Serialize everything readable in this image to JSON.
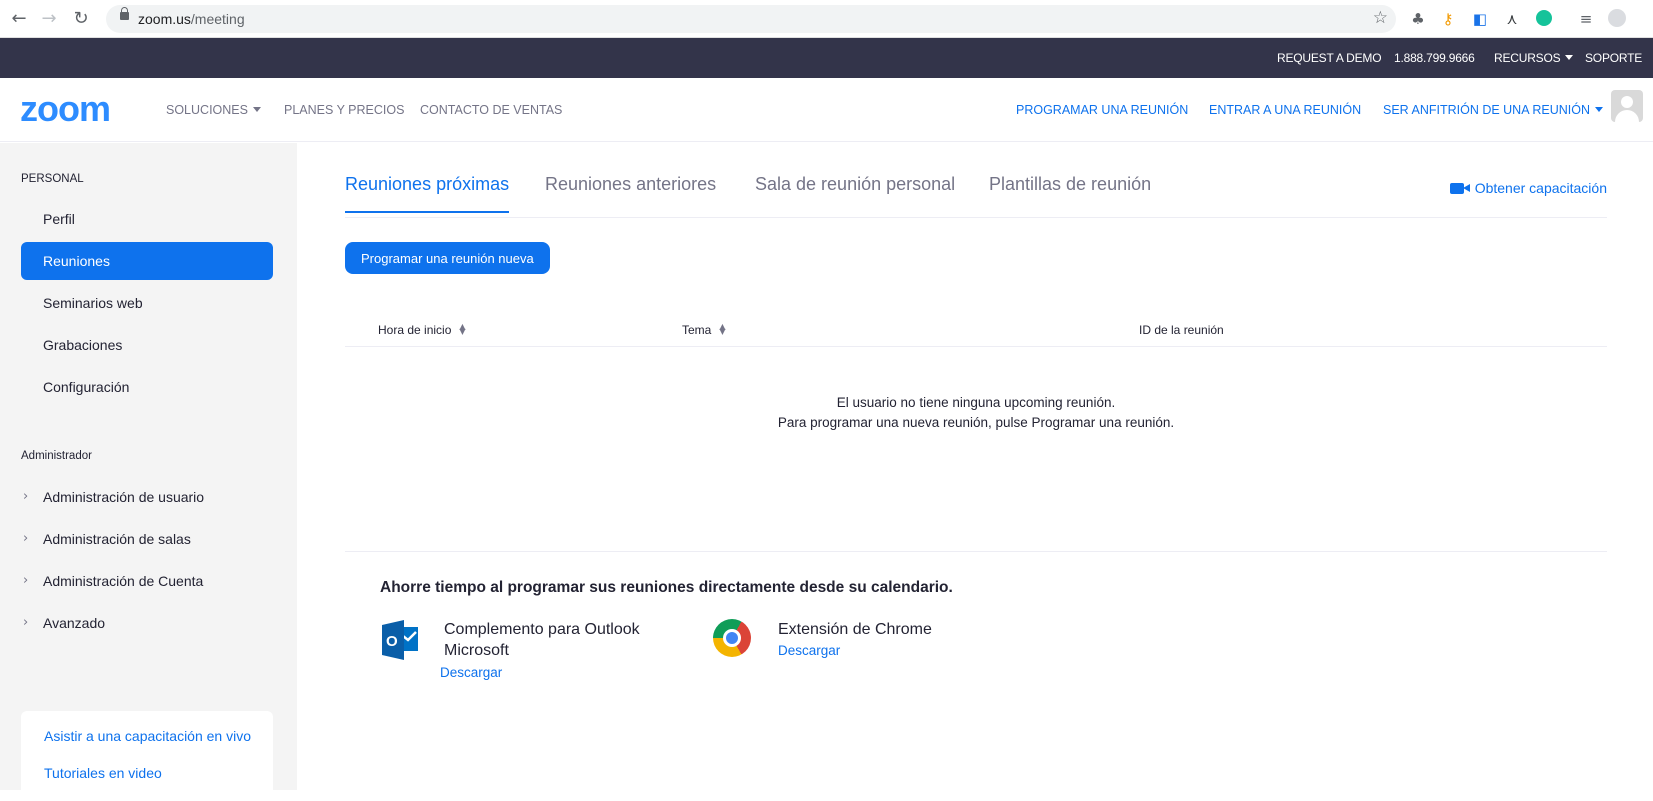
{
  "browser": {
    "url_host": "zoom.us",
    "url_path": "/meeting",
    "back_icon": "←",
    "forward_icon": "→",
    "reload_icon": "↻",
    "star_icon": "☆"
  },
  "topbar": {
    "request_demo": "REQUEST A DEMO",
    "phone": "1.888.799.9666",
    "resources": "RECURSOS",
    "support": "SOPORTE"
  },
  "header": {
    "logo": "zoom",
    "nav": [
      "SOLUCIONES",
      "PLANES Y PRECIOS",
      "CONTACTO DE VENTAS"
    ],
    "schedule": "PROGRAMAR UNA REUNIÓN",
    "join": "ENTRAR A UNA REUNIÓN",
    "host": "SER ANFITRIÓN DE UNA REUNIÓN"
  },
  "sidebar": {
    "personal_title": "PERSONAL",
    "personal_items": [
      "Perfil",
      "Reuniones",
      "Seminarios web",
      "Grabaciones",
      "Configuración"
    ],
    "active_item": "Reuniones",
    "admin_title": "Administrador",
    "admin_items": [
      "Administración de usuario",
      "Administración de salas",
      "Administración de Cuenta",
      "Avanzado"
    ],
    "training_links": [
      "Asistir a una capacitación en vivo",
      "Tutoriales en video"
    ]
  },
  "main": {
    "tabs": [
      "Reuniones próximas",
      "Reuniones anteriores",
      "Sala de reunión personal",
      "Plantillas de reunión"
    ],
    "active_tab": "Reuniones próximas",
    "training_link": "Obtener capacitación",
    "new_meeting_button": "Programar una reunión nueva",
    "columns": [
      "Hora de inicio",
      "Tema",
      "ID de la reunión"
    ],
    "empty_line1": "El usuario no tiene ninguna upcoming reunión.",
    "empty_line2": "Para programar una nueva reunión, pulse Programar una reunión.",
    "calendar_title": "Ahorre tiempo al programar sus reuniones directamente desde su calendario.",
    "outlook_title_1": "Complemento para Outlook",
    "outlook_title_2": "Microsoft",
    "outlook_download": "Descargar",
    "outlook_icon_letter": "O",
    "chrome_title": "Extensión de Chrome",
    "chrome_download": "Descargar"
  },
  "colors": {
    "brand_blue": "#0e72ed",
    "logo_blue": "#2d8cff",
    "topbar_bg": "#33344a",
    "sidebar_bg": "#f4f4f4"
  }
}
